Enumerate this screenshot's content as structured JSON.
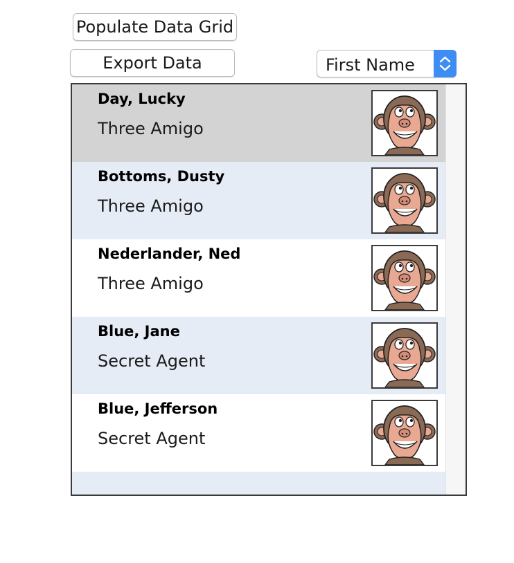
{
  "toolbar": {
    "populate_label": "Populate Data Grid",
    "export_label": "Export Data"
  },
  "sort_select": {
    "selected": "First Name"
  },
  "grid": {
    "rows": [
      {
        "name": "Day, Lucky",
        "role": "Three Amigo",
        "state": "selected"
      },
      {
        "name": "Bottoms, Dusty",
        "role": "Three Amigo",
        "state": "alt"
      },
      {
        "name": "Nederlander, Ned",
        "role": "Three Amigo",
        "state": "plain"
      },
      {
        "name": "Blue, Jane",
        "role": "Secret Agent",
        "state": "alt"
      },
      {
        "name": "Blue, Jefferson",
        "role": "Secret Agent",
        "state": "plain"
      }
    ],
    "avatar_icon": "monkey-face-icon"
  },
  "colors": {
    "selected_row": "#d3d3d3",
    "alt_row": "#e6ecf6",
    "accent": "#3d8df5"
  }
}
